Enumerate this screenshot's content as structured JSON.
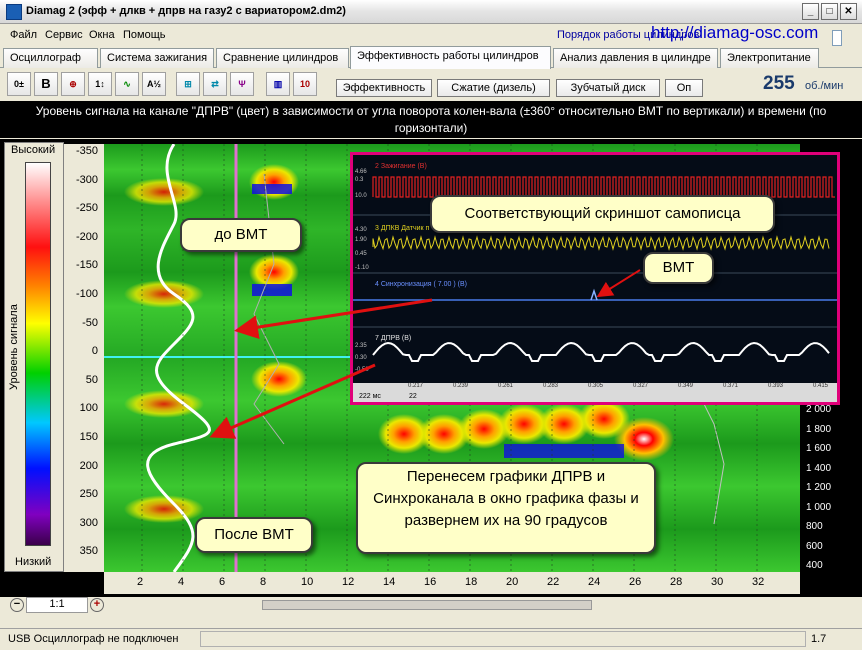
{
  "window": {
    "title": "Diamag 2 (эфф + длкв + дпрв на газу2 с вариатором2.dm2)",
    "min": "_",
    "max": "□",
    "close": "✕"
  },
  "menu": [
    "Файл",
    "Сервис",
    "Окна",
    "Помощь"
  ],
  "order_label": "Порядок работы цилиндров",
  "watermark_url": "http://diamag-osc.com",
  "tabs": [
    "Осциллограф",
    "Система зажигания",
    "Сравнение цилиндров",
    "Эффективность работы цилиндров",
    "Анализ давления в цилиндре",
    "Электропитание"
  ],
  "toolbar_icons": [
    "scale-icon",
    "bold-b-icon",
    "rpm-icon",
    "sort-icon",
    "trend-icon",
    "alg-icon",
    "cylinder-icon",
    "t1234-icon",
    "fork-icon",
    "bar-stack-icon",
    "counter-icon"
  ],
  "subtabs": [
    "Эффективность",
    "Сжатие (дизель)",
    "Зубчатый диск",
    "Оп"
  ],
  "rpm": {
    "value": "255",
    "unit": "об./мин"
  },
  "caption": "Уровень сигнала на канале \"ДПРВ\" (цвет) в зависимости от угла поворота колен-вала (±360° относительно ВМТ по вертикали) и времени (по горизонтали)",
  "colorbar": {
    "high": "Высокий",
    "low": "Низкий",
    "axis_title": "Уровень сигнала"
  },
  "y_ticks": [
    "-350",
    "-300",
    "-250",
    "-200",
    "-150",
    "-100",
    "-50",
    "0",
    "50",
    "100",
    "150",
    "200",
    "250",
    "300",
    "350"
  ],
  "x_ticks": [
    "2",
    "4",
    "6",
    "8",
    "10",
    "12",
    "14",
    "16",
    "18",
    "20",
    "22",
    "24",
    "26",
    "28",
    "30",
    "32"
  ],
  "rpm_ticks": [
    "2 000",
    "1 800",
    "1 600",
    "1 400",
    "1 200",
    "1 000",
    "800",
    "600",
    "400"
  ],
  "callouts": {
    "before_tdc": "до ВМТ",
    "after_tdc": "После ВМТ",
    "recorder": "Соответствующий скриншот самописца",
    "tdc": "ВМТ",
    "transfer": "Перенесем графики ДПРВ и Синхроканала в  окно графика фазы и развернем их на 90 градусов"
  },
  "inset": {
    "channels": [
      "2 Зажигание (В)",
      "3 ДПКВ Датчик п",
      "4 Синхронизация ( 7.00 ) (В)",
      "7 ДПРВ (В)"
    ],
    "ch_values": [
      "4.66",
      "0.3",
      "10.0",
      "4.30",
      "1.90",
      "0.45",
      "-1.10",
      "2.35",
      "0.30",
      "-0.50"
    ],
    "time_ticks": [
      "0.217",
      "0.239",
      "0.261",
      "0.283",
      "0.305",
      "0.327",
      "0.349",
      "0.371",
      "0.393",
      "0.415"
    ],
    "bottom_left": "222 мс",
    "bottom_mid": "22"
  },
  "zoom_label": "1:1",
  "status": {
    "text": "USB Осциллограф не подключен",
    "version": "1.7"
  },
  "colors": {
    "magenta_line": "#E070D0",
    "cyan_line": "#3AF0F0",
    "inset_border": "#E0007A",
    "callout_bg": "#FFFFC8"
  }
}
